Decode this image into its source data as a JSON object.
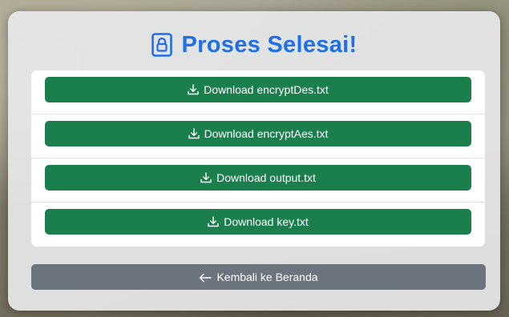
{
  "header": {
    "icon": "lock-icon",
    "title": "Proses Selesai!",
    "title_color": "#1f6fe5"
  },
  "downloads": [
    {
      "icon": "download-icon",
      "label": "Download encryptDes.txt"
    },
    {
      "icon": "download-icon",
      "label": "Download encryptAes.txt"
    },
    {
      "icon": "download-icon",
      "label": "Download output.txt"
    },
    {
      "icon": "download-icon",
      "label": "Download key.txt"
    }
  ],
  "back_button": {
    "icon": "arrow-left-icon",
    "label": "Kembali ke Beranda"
  },
  "colors": {
    "download_button": "#1a7f4d",
    "back_button": "#6c757d"
  }
}
